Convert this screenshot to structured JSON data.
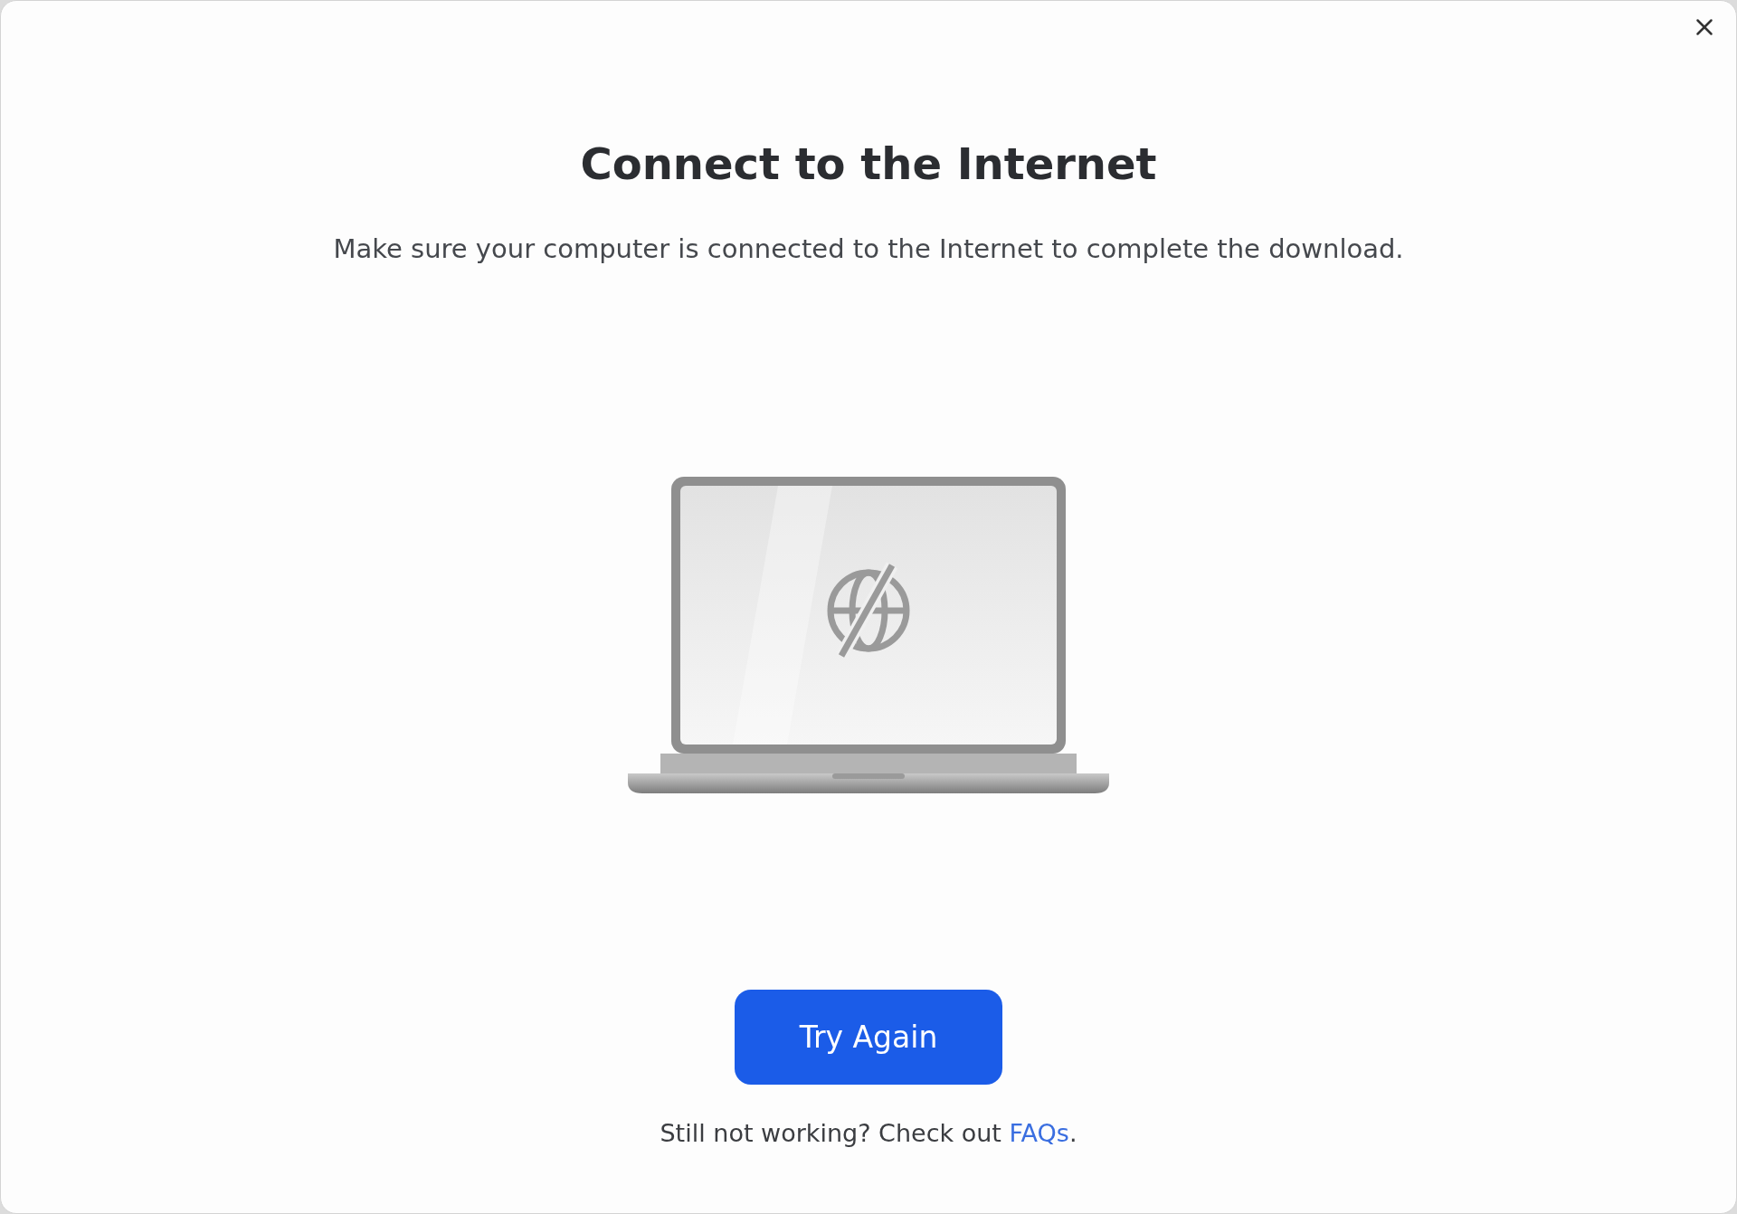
{
  "dialog": {
    "title": "Connect to the Internet",
    "message": "Make sure your computer is connected to the Internet to complete the download.",
    "primary_button": "Try Again",
    "footer": {
      "text": "Still not working? Check out ",
      "link": "FAQs",
      "suffix": "."
    }
  }
}
